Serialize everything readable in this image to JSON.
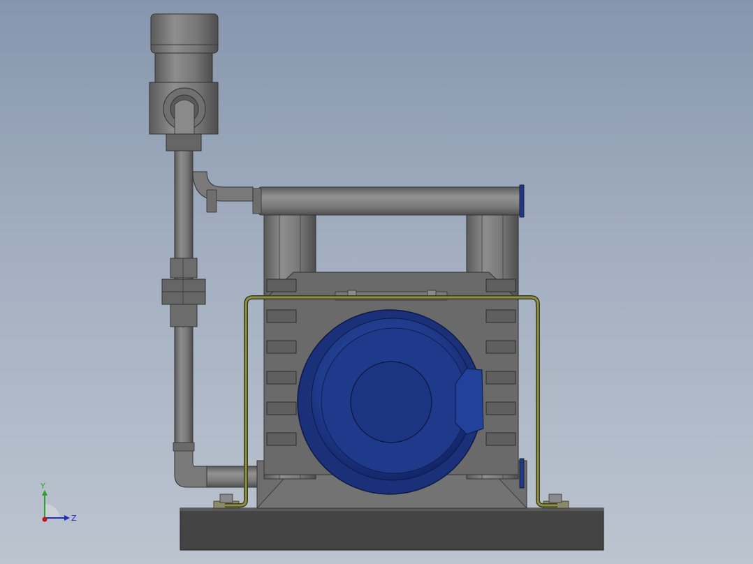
{
  "viewport": {
    "colors": {
      "background_top": "#8796ad",
      "background_bottom": "#bcc4cf",
      "housing_gray": "#7c7c7c",
      "base_dark": "#424242",
      "motor_blue": "#1f3a8a",
      "cable_olive": "#7b7d3a"
    }
  },
  "triad": {
    "y_label": "Y",
    "z_label": "Z",
    "colors": {
      "y_axis": "#2ea02e",
      "z_axis": "#1d2fc0",
      "x_axis": "#c0141c"
    }
  }
}
